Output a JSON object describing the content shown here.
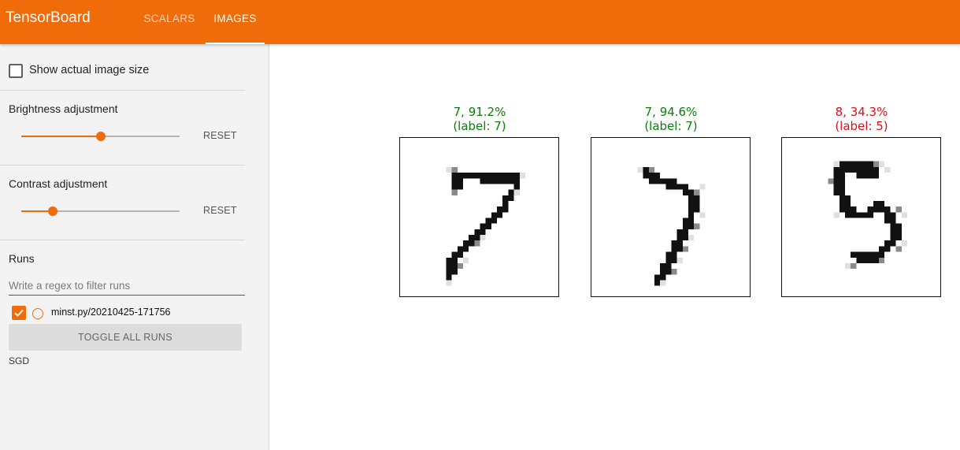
{
  "header": {
    "brand": "TensorBoard",
    "tabs": [
      {
        "label": "SCALARS",
        "active": false
      },
      {
        "label": "IMAGES",
        "active": true
      }
    ],
    "accent_color": "#f06b0a"
  },
  "sidebar": {
    "show_actual_size_label": "Show actual image size",
    "show_actual_size_checked": false,
    "brightness": {
      "title": "Brightness adjustment",
      "value": 0.5,
      "reset_label": "RESET"
    },
    "contrast": {
      "title": "Contrast adjustment",
      "value": 0.2,
      "reset_label": "RESET"
    },
    "runs": {
      "title": "Runs",
      "filter_placeholder": "Write a regex to filter runs",
      "items": [
        {
          "name": "minst.py/20210425-171756",
          "checked": true
        }
      ],
      "toggle_label": "TOGGLE ALL RUNS",
      "tag": "SGD"
    }
  },
  "main": {
    "images": [
      {
        "prediction": "7, 91.2%",
        "label_text": "(label: 7)",
        "correct": true,
        "digit_icon": "handwritten-digit-7"
      },
      {
        "prediction": "7, 94.6%",
        "label_text": "(label: 7)",
        "correct": true,
        "digit_icon": "handwritten-digit-7"
      },
      {
        "prediction": "8, 34.3%",
        "label_text": "(label: 5)",
        "correct": false,
        "digit_icon": "handwritten-digit-5"
      }
    ],
    "colors": {
      "correct": "#0a7d0a",
      "incorrect": "#dc0f1a"
    }
  }
}
